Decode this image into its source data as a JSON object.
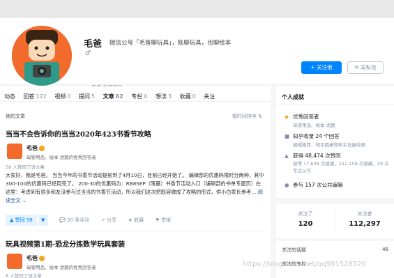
{
  "profile": {
    "name": "毛爸",
    "headline": "微信公号「毛爸聊玩具」，既聊玩具，也聊绘本",
    "gender_symbol": "♂",
    "detail_link": "查看详细资料",
    "follow_button": "关注他",
    "message_button": "发私信"
  },
  "tabs": [
    {
      "label": "动态",
      "count": ""
    },
    {
      "label": "回答",
      "count": "122"
    },
    {
      "label": "视频",
      "count": "0"
    },
    {
      "label": "提问",
      "count": "5"
    },
    {
      "label": "文章",
      "count": "62"
    },
    {
      "label": "专栏",
      "count": "0"
    },
    {
      "label": "想法",
      "count": "3"
    },
    {
      "label": "收藏",
      "count": "0"
    },
    {
      "label": "关注",
      "count": ""
    }
  ],
  "section": {
    "title": "他的文章",
    "sort": "按时间排序"
  },
  "articles": [
    {
      "title": "当当不会告诉你的当当2020年423书香节攻略",
      "author": "毛爸",
      "author_desc": "母婴用品、绘本 话题的优秀回答者",
      "votes_line": "58 人赞同了该文章",
      "excerpt": "大家好，我是毛爸。 当当今年的书香节活动提前到了4月10日，目前已经开始了。 编辑部的优惠码限时分两种，其中300-100的优惠码已经用完了。 200-30的优惠码为：RB8SEP（限量）书香节活动入口（编辑部的书单专题页）在这里：考虑到有很多和友没参与过当当的书香节活动，所以我们这次把既容做成了攻略的形式，供小白家长参考…",
      "read_all": "阅读全文",
      "upvote": "▲ 赞同 58",
      "downvote": "▼",
      "actions": [
        "💬 20 条评论",
        "↗ 分享",
        "★ 收藏",
        "⚑ 举报"
      ]
    },
    {
      "title": "玩具视频第1期-恐龙分拣数学玩具套装",
      "author": "毛爸",
      "author_desc": "母婴用品、绘本 话题的优秀回答者",
      "votes_line": "8 人赞同了该文章"
    }
  ],
  "achievements": {
    "title": "个人成就",
    "items": [
      {
        "icon": "◆",
        "label": "优秀回答者",
        "sub": "母婴用品、绘本 话题"
      },
      {
        "icon": "■",
        "label": "知乎收录 24 个回答",
        "sub": "编辑推荐、知乎圆桌和知乎日报收录"
      },
      {
        "icon": "▲",
        "label": "获得 48,474 次赞同",
        "sub": "获得 17,638 次感谢，112,158 次收藏，29 次专业认可"
      },
      {
        "icon": "●",
        "label": "参与 157 次公共编辑",
        "sub": ""
      }
    ]
  },
  "follow_stats": [
    {
      "label": "关注了",
      "value": "120"
    },
    {
      "label": "关注者",
      "value": "112,297"
    }
  ],
  "topics": [
    {
      "label": "关注的话题",
      "count": "46"
    },
    {
      "label": "关注的专栏",
      "count": ""
    }
  ],
  "watermark": "https://blog.csdn.net/qq591528520"
}
